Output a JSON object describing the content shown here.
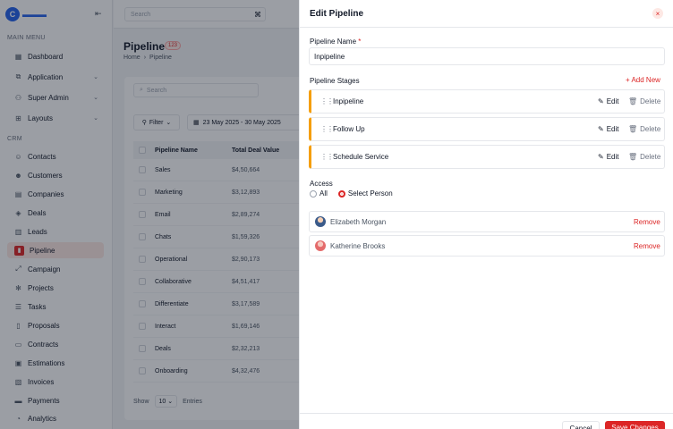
{
  "sidebar": {
    "logo_letter": "C",
    "main_menu_label": "MAIN MENU",
    "main_items": [
      {
        "label": "Dashboard",
        "icon": "grid-icon"
      },
      {
        "label": "Application",
        "icon": "apps-icon"
      },
      {
        "label": "Super Admin",
        "icon": "user-shield-icon"
      },
      {
        "label": "Layouts",
        "icon": "layout-icon"
      }
    ],
    "crm_label": "CRM",
    "crm_items": [
      {
        "label": "Contacts",
        "icon": "user-icon"
      },
      {
        "label": "Customers",
        "icon": "users-icon"
      },
      {
        "label": "Companies",
        "icon": "building-icon"
      },
      {
        "label": "Deals",
        "icon": "deal-icon"
      },
      {
        "label": "Leads",
        "icon": "chart-icon"
      },
      {
        "label": "Pipeline",
        "icon": "pipeline-icon"
      },
      {
        "label": "Campaign",
        "icon": "campaign-icon"
      },
      {
        "label": "Projects",
        "icon": "atom-icon"
      },
      {
        "label": "Tasks",
        "icon": "list-icon"
      },
      {
        "label": "Proposals",
        "icon": "file-icon"
      },
      {
        "label": "Contracts",
        "icon": "contract-icon"
      },
      {
        "label": "Estimations",
        "icon": "estimate-icon"
      },
      {
        "label": "Invoices",
        "icon": "invoice-icon"
      },
      {
        "label": "Payments",
        "icon": "payment-icon"
      },
      {
        "label": "Analytics",
        "icon": "analytics-icon"
      }
    ],
    "active_item": "Pipeline"
  },
  "topbar": {
    "search_placeholder": "Search",
    "search_kbd": "⌘"
  },
  "page": {
    "title": "Pipeline",
    "count": "123",
    "breadcrumb": {
      "home": "Home",
      "separator": "›",
      "current": "Pipeline"
    }
  },
  "table": {
    "search_placeholder": "Search",
    "filter_label": "Filter",
    "date_range": "23 May 2025 - 30 May 2025",
    "columns": [
      "Pipeline Name",
      "Total Deal Value"
    ],
    "rows": [
      {
        "name": "Sales",
        "value": "$4,50,664"
      },
      {
        "name": "Marketing",
        "value": "$3,12,893"
      },
      {
        "name": "Email",
        "value": "$2,89,274"
      },
      {
        "name": "Chats",
        "value": "$1,59,326"
      },
      {
        "name": "Operational",
        "value": "$2,90,173"
      },
      {
        "name": "Collaborative",
        "value": "$4,51,417"
      },
      {
        "name": "Differentiate",
        "value": "$3,17,589"
      },
      {
        "name": "Interact",
        "value": "$1,69,146"
      },
      {
        "name": "Deals",
        "value": "$2,32,213"
      },
      {
        "name": "Onboarding",
        "value": "$4,32,476"
      }
    ],
    "pager": {
      "show": "Show",
      "per_page": "10",
      "entries": "Entries"
    }
  },
  "modal": {
    "title": "Edit Pipeline",
    "close_icon": "×",
    "name_label": "Pipeline Name",
    "required_mark": "*",
    "name_value": "Inpipeline",
    "stages_label": "Pipeline Stages",
    "add_new_label": "+ Add New",
    "stages": [
      {
        "name": "Inpipeline"
      },
      {
        "name": "Follow Up"
      },
      {
        "name": "Schedule Service"
      }
    ],
    "edit_label": "Edit",
    "delete_label": "Delete",
    "access_label": "Access",
    "access_options": [
      {
        "label": "All",
        "selected": false
      },
      {
        "label": "Select Person",
        "selected": true
      }
    ],
    "persons": [
      {
        "name": "Elizabeth Morgan"
      },
      {
        "name": "Katherine Brooks"
      }
    ],
    "remove_label": "Remove",
    "cancel_label": "Cancel",
    "save_label": "Save Changes"
  },
  "colors": {
    "accent": "#dc2626",
    "stage_border": "#f59e0b",
    "logo": "#2563eb"
  }
}
